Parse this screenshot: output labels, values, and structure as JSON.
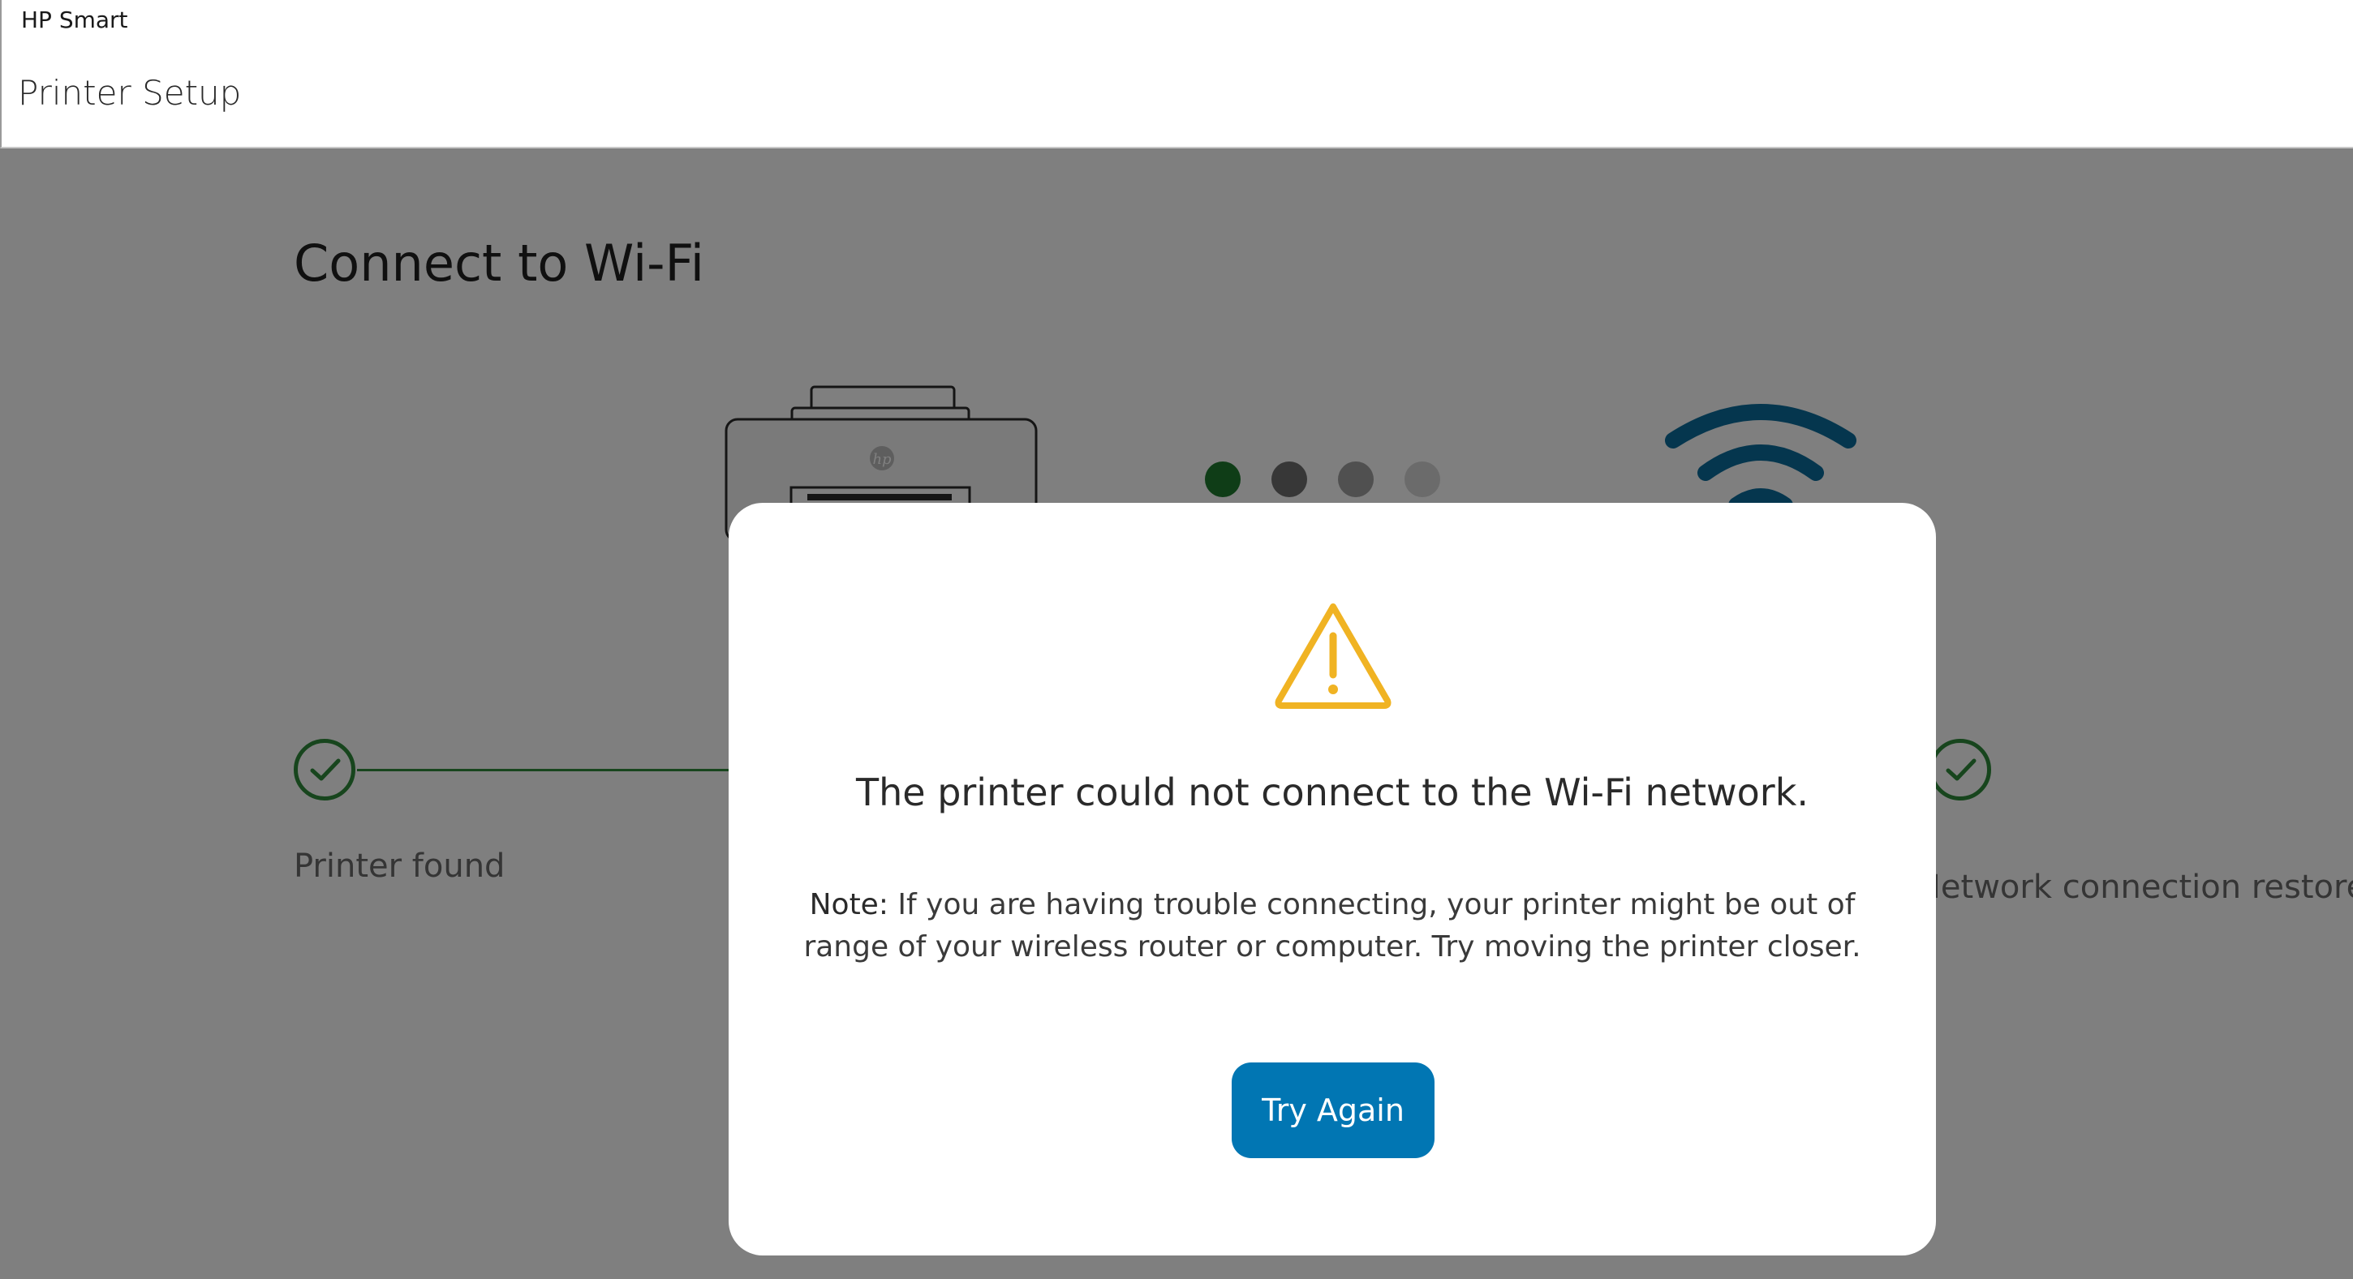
{
  "window": {
    "title": "HP Smart"
  },
  "header": {
    "title": "Printer Setup"
  },
  "main": {
    "title": "Connect to Wi-Fi",
    "progress_dots": [
      {
        "state": "active",
        "color": "#1e7b2e"
      },
      {
        "state": "pending",
        "color": "#6e6e6e"
      },
      {
        "state": "pending",
        "color": "#a0a0a0"
      },
      {
        "state": "pending",
        "color": "#d6d6d6"
      }
    ],
    "steps": [
      {
        "label": "Printer found",
        "status": "complete"
      },
      {
        "label": "Network connection restored",
        "status": "complete"
      }
    ],
    "printer_logo": "hp"
  },
  "dialog": {
    "icon": "warning-icon",
    "icon_color": "#f0b323",
    "title": "The printer could not connect to the Wi-Fi network.",
    "note_label": "Note:",
    "note_text": " If you are having trouble connecting, your printer might be out of range of your wireless router or computer. Try moving the printer closer.",
    "button_label": "Try Again",
    "button_color": "#0176b3"
  },
  "colors": {
    "success": "#2e8b3a",
    "wifi": "#0b6d9c"
  }
}
